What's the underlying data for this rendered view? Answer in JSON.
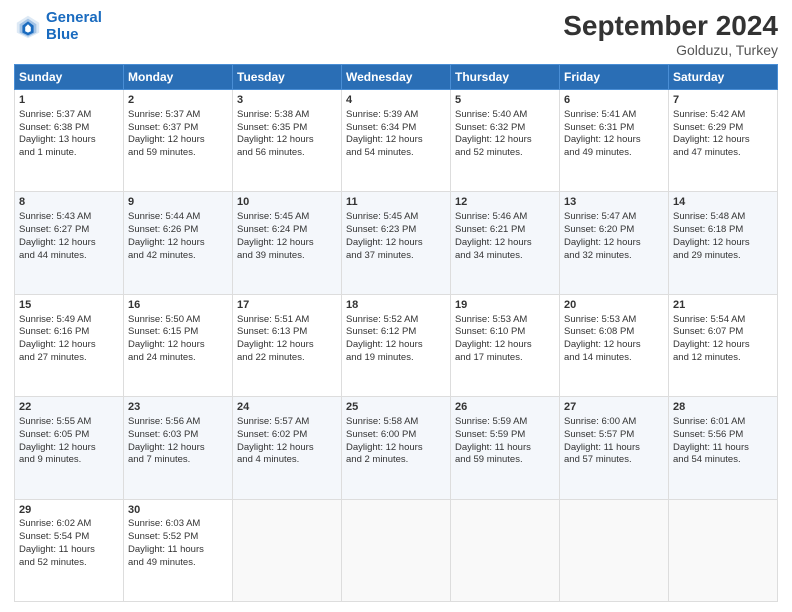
{
  "header": {
    "logo_line1": "General",
    "logo_line2": "Blue",
    "month": "September 2024",
    "location": "Golduzu, Turkey"
  },
  "days_of_week": [
    "Sunday",
    "Monday",
    "Tuesday",
    "Wednesday",
    "Thursday",
    "Friday",
    "Saturday"
  ],
  "weeks": [
    [
      {
        "day": "1",
        "info": "Sunrise: 5:37 AM\nSunset: 6:38 PM\nDaylight: 13 hours\nand 1 minute."
      },
      {
        "day": "2",
        "info": "Sunrise: 5:37 AM\nSunset: 6:37 PM\nDaylight: 12 hours\nand 59 minutes."
      },
      {
        "day": "3",
        "info": "Sunrise: 5:38 AM\nSunset: 6:35 PM\nDaylight: 12 hours\nand 56 minutes."
      },
      {
        "day": "4",
        "info": "Sunrise: 5:39 AM\nSunset: 6:34 PM\nDaylight: 12 hours\nand 54 minutes."
      },
      {
        "day": "5",
        "info": "Sunrise: 5:40 AM\nSunset: 6:32 PM\nDaylight: 12 hours\nand 52 minutes."
      },
      {
        "day": "6",
        "info": "Sunrise: 5:41 AM\nSunset: 6:31 PM\nDaylight: 12 hours\nand 49 minutes."
      },
      {
        "day": "7",
        "info": "Sunrise: 5:42 AM\nSunset: 6:29 PM\nDaylight: 12 hours\nand 47 minutes."
      }
    ],
    [
      {
        "day": "8",
        "info": "Sunrise: 5:43 AM\nSunset: 6:27 PM\nDaylight: 12 hours\nand 44 minutes."
      },
      {
        "day": "9",
        "info": "Sunrise: 5:44 AM\nSunset: 6:26 PM\nDaylight: 12 hours\nand 42 minutes."
      },
      {
        "day": "10",
        "info": "Sunrise: 5:45 AM\nSunset: 6:24 PM\nDaylight: 12 hours\nand 39 minutes."
      },
      {
        "day": "11",
        "info": "Sunrise: 5:45 AM\nSunset: 6:23 PM\nDaylight: 12 hours\nand 37 minutes."
      },
      {
        "day": "12",
        "info": "Sunrise: 5:46 AM\nSunset: 6:21 PM\nDaylight: 12 hours\nand 34 minutes."
      },
      {
        "day": "13",
        "info": "Sunrise: 5:47 AM\nSunset: 6:20 PM\nDaylight: 12 hours\nand 32 minutes."
      },
      {
        "day": "14",
        "info": "Sunrise: 5:48 AM\nSunset: 6:18 PM\nDaylight: 12 hours\nand 29 minutes."
      }
    ],
    [
      {
        "day": "15",
        "info": "Sunrise: 5:49 AM\nSunset: 6:16 PM\nDaylight: 12 hours\nand 27 minutes."
      },
      {
        "day": "16",
        "info": "Sunrise: 5:50 AM\nSunset: 6:15 PM\nDaylight: 12 hours\nand 24 minutes."
      },
      {
        "day": "17",
        "info": "Sunrise: 5:51 AM\nSunset: 6:13 PM\nDaylight: 12 hours\nand 22 minutes."
      },
      {
        "day": "18",
        "info": "Sunrise: 5:52 AM\nSunset: 6:12 PM\nDaylight: 12 hours\nand 19 minutes."
      },
      {
        "day": "19",
        "info": "Sunrise: 5:53 AM\nSunset: 6:10 PM\nDaylight: 12 hours\nand 17 minutes."
      },
      {
        "day": "20",
        "info": "Sunrise: 5:53 AM\nSunset: 6:08 PM\nDaylight: 12 hours\nand 14 minutes."
      },
      {
        "day": "21",
        "info": "Sunrise: 5:54 AM\nSunset: 6:07 PM\nDaylight: 12 hours\nand 12 minutes."
      }
    ],
    [
      {
        "day": "22",
        "info": "Sunrise: 5:55 AM\nSunset: 6:05 PM\nDaylight: 12 hours\nand 9 minutes."
      },
      {
        "day": "23",
        "info": "Sunrise: 5:56 AM\nSunset: 6:03 PM\nDaylight: 12 hours\nand 7 minutes."
      },
      {
        "day": "24",
        "info": "Sunrise: 5:57 AM\nSunset: 6:02 PM\nDaylight: 12 hours\nand 4 minutes."
      },
      {
        "day": "25",
        "info": "Sunrise: 5:58 AM\nSunset: 6:00 PM\nDaylight: 12 hours\nand 2 minutes."
      },
      {
        "day": "26",
        "info": "Sunrise: 5:59 AM\nSunset: 5:59 PM\nDaylight: 11 hours\nand 59 minutes."
      },
      {
        "day": "27",
        "info": "Sunrise: 6:00 AM\nSunset: 5:57 PM\nDaylight: 11 hours\nand 57 minutes."
      },
      {
        "day": "28",
        "info": "Sunrise: 6:01 AM\nSunset: 5:56 PM\nDaylight: 11 hours\nand 54 minutes."
      }
    ],
    [
      {
        "day": "29",
        "info": "Sunrise: 6:02 AM\nSunset: 5:54 PM\nDaylight: 11 hours\nand 52 minutes."
      },
      {
        "day": "30",
        "info": "Sunrise: 6:03 AM\nSunset: 5:52 PM\nDaylight: 11 hours\nand 49 minutes."
      },
      {
        "day": "",
        "info": ""
      },
      {
        "day": "",
        "info": ""
      },
      {
        "day": "",
        "info": ""
      },
      {
        "day": "",
        "info": ""
      },
      {
        "day": "",
        "info": ""
      }
    ]
  ]
}
